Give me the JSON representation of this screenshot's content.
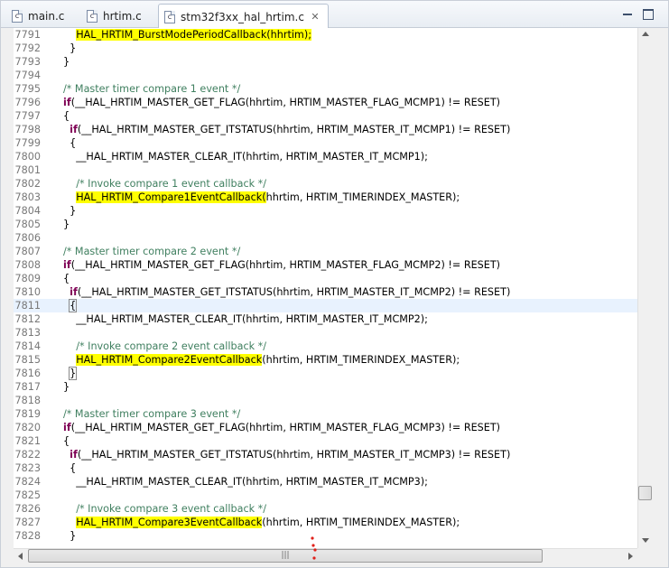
{
  "tabs": [
    {
      "label": "main.c",
      "active": false
    },
    {
      "label": "hrtim.c",
      "active": false
    },
    {
      "label": "stm32f3xx_hal_hrtim.c",
      "active": true
    }
  ],
  "editor": {
    "lines": [
      {
        "n": "7791",
        "parts": [
          {
            "t": "    "
          },
          {
            "t": "HAL_HRTIM_BurstModePeriodCallback(hhrtim);",
            "c": "hl"
          }
        ]
      },
      {
        "n": "7792",
        "parts": [
          {
            "t": "  }"
          }
        ]
      },
      {
        "n": "7793",
        "parts": [
          {
            "t": "}"
          }
        ]
      },
      {
        "n": "7794",
        "parts": []
      },
      {
        "n": "7795",
        "parts": [
          {
            "t": "/* Master timer compare 1 event */",
            "c": "cm"
          }
        ]
      },
      {
        "n": "7796",
        "parts": [
          {
            "t": "if",
            "c": "kw"
          },
          {
            "t": "(__HAL_HRTIM_MASTER_GET_FLAG(hhrtim, HRTIM_MASTER_FLAG_MCMP1) != RESET)"
          }
        ]
      },
      {
        "n": "7797",
        "parts": [
          {
            "t": "{"
          }
        ]
      },
      {
        "n": "7798",
        "parts": [
          {
            "t": "  "
          },
          {
            "t": "if",
            "c": "kw"
          },
          {
            "t": "(__HAL_HRTIM_MASTER_GET_ITSTATUS(hhrtim, HRTIM_MASTER_IT_MCMP1) != RESET)"
          }
        ]
      },
      {
        "n": "7799",
        "parts": [
          {
            "t": "  {"
          }
        ]
      },
      {
        "n": "7800",
        "parts": [
          {
            "t": "    __HAL_HRTIM_MASTER_CLEAR_IT(hhrtim, HRTIM_MASTER_IT_MCMP1);"
          }
        ]
      },
      {
        "n": "7801",
        "parts": []
      },
      {
        "n": "7802",
        "parts": [
          {
            "t": "    "
          },
          {
            "t": "/* Invoke compare 1 event callback */",
            "c": "cm"
          }
        ]
      },
      {
        "n": "7803",
        "parts": [
          {
            "t": "    "
          },
          {
            "t": "HAL_HRTIM_Compare1EventCallback(",
            "c": "hl"
          },
          {
            "t": "hhrtim, HRTIM_TIMERINDEX_MASTER);"
          }
        ]
      },
      {
        "n": "7804",
        "parts": [
          {
            "t": "  }"
          }
        ]
      },
      {
        "n": "7805",
        "parts": [
          {
            "t": "}"
          }
        ]
      },
      {
        "n": "7806",
        "parts": []
      },
      {
        "n": "7807",
        "parts": [
          {
            "t": "/* Master timer compare 2 event */",
            "c": "cm"
          }
        ]
      },
      {
        "n": "7808",
        "parts": [
          {
            "t": "if",
            "c": "kw"
          },
          {
            "t": "(__HAL_HRTIM_MASTER_GET_FLAG(hhrtim, HRTIM_MASTER_FLAG_MCMP2) != RESET)"
          }
        ]
      },
      {
        "n": "7809",
        "parts": [
          {
            "t": "{"
          }
        ]
      },
      {
        "n": "7810",
        "parts": [
          {
            "t": "  "
          },
          {
            "t": "if",
            "c": "kw"
          },
          {
            "t": "(__HAL_HRTIM_MASTER_GET_ITSTATUS(hhrtim, HRTIM_MASTER_IT_MCMP2) != RESET)"
          }
        ]
      },
      {
        "n": "7811",
        "parts": [
          {
            "t": "  "
          },
          {
            "t": "{",
            "c": "box"
          }
        ],
        "current": true
      },
      {
        "n": "7812",
        "parts": [
          {
            "t": "    __HAL_HRTIM_MASTER_CLEAR_IT(hhrtim, HRTIM_MASTER_IT_MCMP2);"
          }
        ]
      },
      {
        "n": "7813",
        "parts": []
      },
      {
        "n": "7814",
        "parts": [
          {
            "t": "    "
          },
          {
            "t": "/* Invoke compare 2 event callback */",
            "c": "cm"
          }
        ]
      },
      {
        "n": "7815",
        "parts": [
          {
            "t": "    "
          },
          {
            "t": "HAL_HRTIM_Compare2EventCallback",
            "c": "hl"
          },
          {
            "t": "(hhrtim, HRTIM_TIMERINDEX_MASTER);"
          }
        ]
      },
      {
        "n": "7816",
        "parts": [
          {
            "t": "  "
          },
          {
            "t": "}",
            "c": "box"
          }
        ]
      },
      {
        "n": "7817",
        "parts": [
          {
            "t": "}"
          }
        ]
      },
      {
        "n": "7818",
        "parts": []
      },
      {
        "n": "7819",
        "parts": [
          {
            "t": "/* Master timer compare 3 event */",
            "c": "cm"
          }
        ]
      },
      {
        "n": "7820",
        "parts": [
          {
            "t": "if",
            "c": "kw"
          },
          {
            "t": "(__HAL_HRTIM_MASTER_GET_FLAG(hhrtim, HRTIM_MASTER_FLAG_MCMP3) != RESET)"
          }
        ]
      },
      {
        "n": "7821",
        "parts": [
          {
            "t": "{"
          }
        ]
      },
      {
        "n": "7822",
        "parts": [
          {
            "t": "  "
          },
          {
            "t": "if",
            "c": "kw"
          },
          {
            "t": "(__HAL_HRTIM_MASTER_GET_ITSTATUS(hhrtim, HRTIM_MASTER_IT_MCMP3) != RESET)"
          }
        ]
      },
      {
        "n": "7823",
        "parts": [
          {
            "t": "  {"
          }
        ]
      },
      {
        "n": "7824",
        "parts": [
          {
            "t": "    __HAL_HRTIM_MASTER_CLEAR_IT(hhrtim, HRTIM_MASTER_IT_MCMP3);"
          }
        ]
      },
      {
        "n": "7825",
        "parts": []
      },
      {
        "n": "7826",
        "parts": [
          {
            "t": "    "
          },
          {
            "t": "/* Invoke compare 3 event callback */",
            "c": "cm"
          }
        ]
      },
      {
        "n": "7827",
        "parts": [
          {
            "t": "    "
          },
          {
            "t": "HAL_HRTIM_Compare3EventCallback",
            "c": "hl"
          },
          {
            "t": "(hhrtim, HRTIM_TIMERINDEX_MASTER);"
          }
        ]
      },
      {
        "n": "7828",
        "parts": [
          {
            "t": "  }"
          }
        ]
      }
    ]
  },
  "scrollbars": {
    "vertical_position": 0.93,
    "horizontal_position": 0.0
  },
  "colors": {
    "keyword": "#7f0055",
    "comment": "#3f7f5f",
    "highlight": "#ffff00",
    "current_line": "#e8f2fe",
    "line_number": "#787878"
  },
  "icons": {
    "tab_file": "c-source-file-icon",
    "tab_close": "close-icon",
    "minimize": "minimize-icon",
    "maximize": "maximize-icon"
  }
}
